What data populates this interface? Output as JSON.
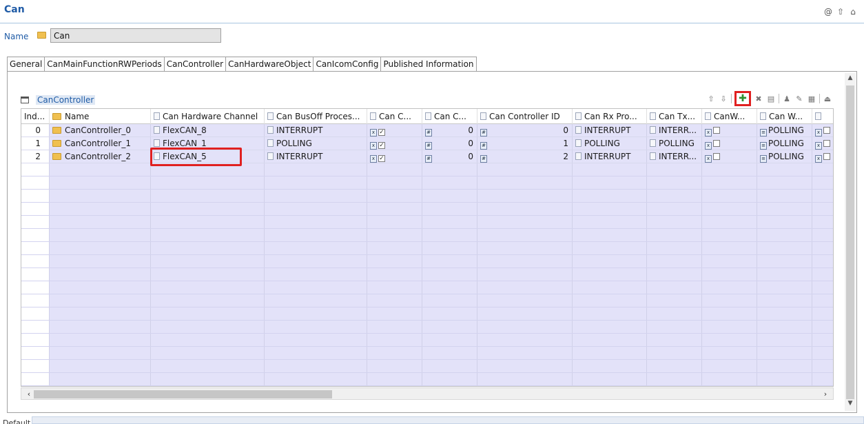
{
  "header": {
    "title": "Can",
    "icons": [
      "at-icon",
      "up-arrow-icon",
      "home-icon"
    ]
  },
  "name_field": {
    "label": "Name",
    "value": "Can"
  },
  "tabs": [
    {
      "label": "General"
    },
    {
      "label": "CanMainFunctionRWPeriods"
    },
    {
      "label": "CanController",
      "active": true
    },
    {
      "label": "CanHardwareObject"
    },
    {
      "label": "CanIcomConfig"
    },
    {
      "label": "Published Information"
    }
  ],
  "section": {
    "title": "CanController"
  },
  "toolbar": {
    "icons": [
      "move-up-icon",
      "move-down-icon",
      "add-icon",
      "delete-icon",
      "copy-icon",
      "person-icon",
      "edit-icon",
      "table-icon",
      "export-icon"
    ]
  },
  "table": {
    "headers": [
      "Ind...",
      "Name",
      "Can Hardware Channel",
      "Can BusOff Proces...",
      "Can C...",
      "Can C...",
      "Can Controller ID",
      "Can Rx Pro...",
      "Can Tx...",
      "CanW...",
      "Can W...",
      ""
    ],
    "rows": [
      {
        "index": "0",
        "name": "CanController_0",
        "channel": "FlexCAN_8",
        "busoff": "INTERRUPT",
        "c1_checked": "✓",
        "c2": "0",
        "id": "0",
        "rx": "INTERRUPT",
        "tx": "INTERR...",
        "w1_checked": "",
        "w2": "POLLING",
        "w3_checked": ""
      },
      {
        "index": "1",
        "name": "CanController_1",
        "channel": "FlexCAN_1",
        "busoff": "POLLING",
        "c1_checked": "✓",
        "c2": "0",
        "id": "1",
        "rx": "POLLING",
        "tx": "POLLING",
        "w1_checked": "",
        "w2": "POLLING",
        "w3_checked": ""
      },
      {
        "index": "2",
        "name": "CanController_2",
        "channel": "FlexCAN_5",
        "busoff": "INTERRUPT",
        "c1_checked": "✓",
        "c2": "0",
        "id": "2",
        "rx": "INTERRUPT",
        "tx": "INTERR...",
        "w1_checked": "",
        "w2": "POLLING",
        "w3_checked": ""
      }
    ]
  },
  "footer": {
    "label": "Default"
  },
  "colors": {
    "accent": "#1f5ba6",
    "highlight": "#e02020",
    "grid_bg": "#e3e2f9"
  }
}
